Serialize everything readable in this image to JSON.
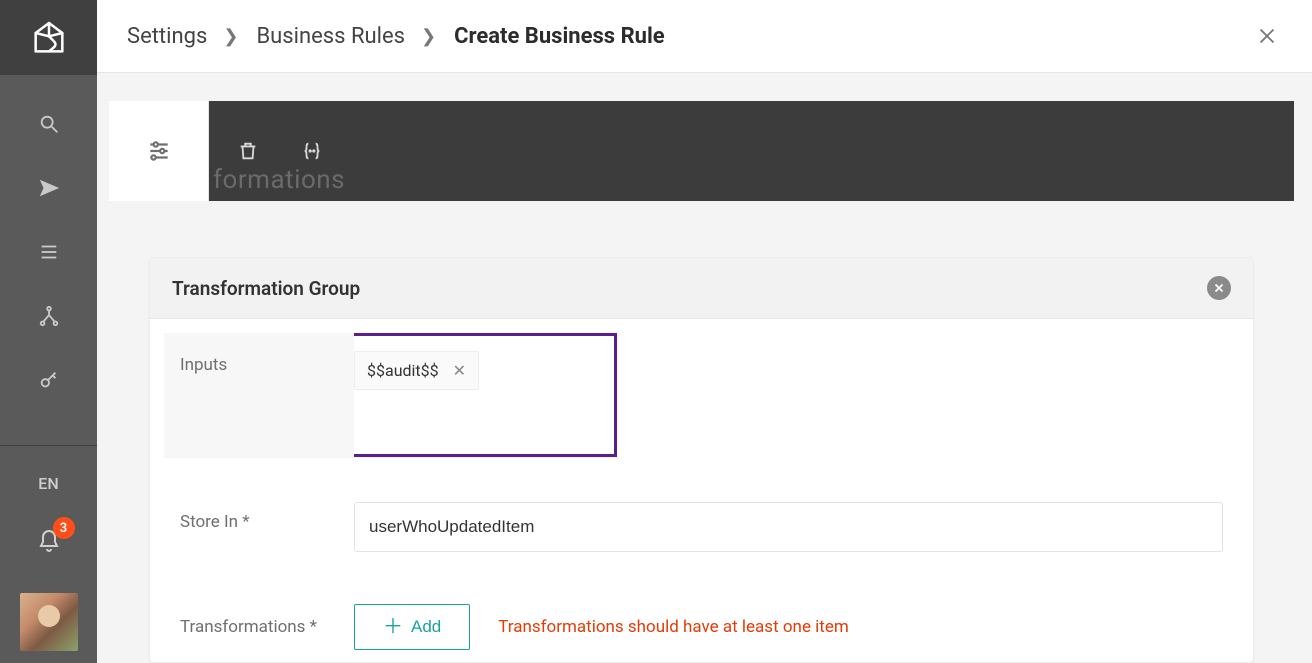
{
  "sidebar": {
    "language": "EN",
    "notifications": "3"
  },
  "breadcrumb": [
    "Settings",
    "Business Rules",
    "Create Business Rule"
  ],
  "toolbar": {
    "ghost_label": "formations"
  },
  "card": {
    "title": "Transformation Group",
    "inputs_label": "Inputs",
    "inputs": [
      "$$audit$$"
    ],
    "store_in_label": "Store In *",
    "store_in_value": "userWhoUpdatedItem",
    "transformations_label": "Transformations *",
    "add_button": "Add",
    "error": "Transformations should have at least one item"
  }
}
